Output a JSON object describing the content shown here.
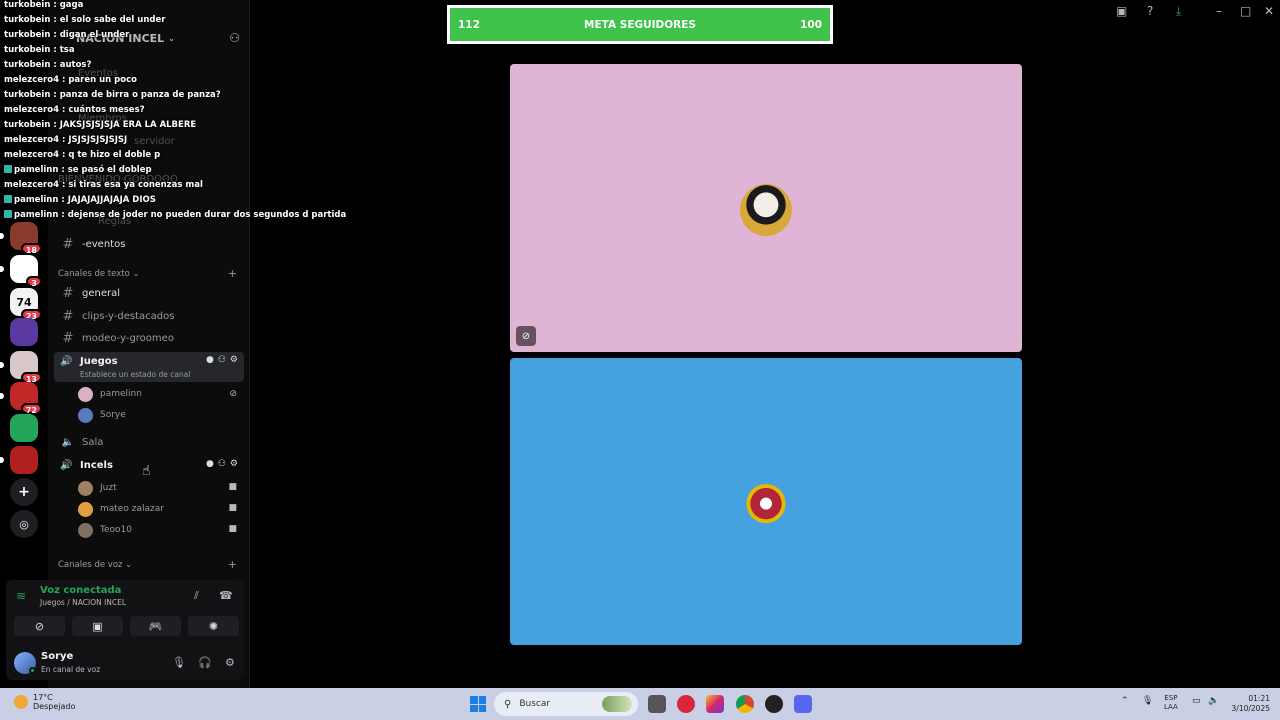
{
  "goal_bar": {
    "left_value": "112",
    "title": "META SEGUIDORES",
    "right_value": "100"
  },
  "server": {
    "name": "NACION INCEL",
    "faded_items": [
      "Eventos",
      "Miembros",
      "servidor",
      "BIENVENIDO GORDOOO",
      "Reglas"
    ],
    "rail": [
      {
        "label": "",
        "badge": "18",
        "color": "#8a3b2c"
      },
      {
        "label": "",
        "badge": "3",
        "color": "#ffffff"
      },
      {
        "label": "74",
        "badge": "23",
        "color": "#f2f2f2"
      },
      {
        "label": "",
        "badge": "",
        "color": "#5a3aa0"
      },
      {
        "label": "",
        "badge": "13",
        "color": "#d8c8c8"
      },
      {
        "label": "",
        "badge": "72",
        "color": "#c02828"
      },
      {
        "label": "",
        "badge": "",
        "color": "#23a55a"
      },
      {
        "label": "",
        "badge": "",
        "color": "#b02020"
      }
    ]
  },
  "channels": {
    "events_channel": "-eventos",
    "text_category": "Canales de texto",
    "text_channels": [
      "general",
      "clips-y-destacados",
      "modeo-y-groomeo"
    ],
    "voice_category": "Canales de voz",
    "voice_juegos": {
      "name": "Juegos",
      "status": "Establece un estado de canal",
      "members": [
        "pamelinn",
        "Sorye"
      ]
    },
    "voice_sala": "Sala",
    "voice_incels": {
      "name": "Incels",
      "members": [
        "Juzt",
        "mateo zalazar",
        "Teoo10"
      ]
    }
  },
  "voice_panel": {
    "status": "Voz conectada",
    "location": "Juegos / NACION INCEL"
  },
  "user": {
    "name": "Sorye",
    "status": "En canal de voz"
  },
  "chat": [
    {
      "user": "turkobein",
      "text": "gaga",
      "color": "#ffffff"
    },
    {
      "user": "turkobein",
      "text": "el solo sabe del under",
      "color": "#ffffff"
    },
    {
      "user": "turkobein",
      "text": "digan el under",
      "color": "#ffffff"
    },
    {
      "user": "turkobein",
      "text": "tsa",
      "color": "#ffffff"
    },
    {
      "user": "turkobein",
      "text": "autos?",
      "color": "#ffffff"
    },
    {
      "user": "melezcero4",
      "text": "paren un poco",
      "color": "#ffffff"
    },
    {
      "user": "turkobein",
      "text": "panza de birra o panza de panza?",
      "color": "#ffffff"
    },
    {
      "user": "melezcero4",
      "text": "cuántos meses?",
      "color": "#ffffff"
    },
    {
      "user": "turkobein",
      "text": "JAKSJSJSJSJA ERA LA ALBERE",
      "color": "#ffffff"
    },
    {
      "user": "melezcero4",
      "text": "JSJSJSJSJSJSJ",
      "color": "#ffffff"
    },
    {
      "user": "melezcero4",
      "text": "q te hizo el doble p",
      "color": "#ffffff"
    },
    {
      "user": "pamelinn",
      "text": "se pasó el doblep",
      "color": "#ffffff"
    },
    {
      "user": "melezcero4",
      "text": "si tiras esa ya conenzas mal",
      "color": "#ffffff"
    },
    {
      "user": "pamelinn",
      "text": "JAJAJAJJAJAJA DIOS",
      "color": "#ffffff"
    },
    {
      "user": "pamelinn",
      "text": "dejense de joder no pueden durar dos segundos d partida",
      "color": "#ffffff"
    }
  ],
  "taskbar": {
    "weather_temp": "17°C",
    "weather_desc": "Despejado",
    "search_placeholder": "Buscar",
    "lang_top": "ESP",
    "lang_bottom": "LAA",
    "time": "01:21",
    "date": "3/10/2025"
  },
  "colors": {
    "tile_top": "#e0b4d4",
    "tile_bottom": "#45a1e0",
    "goal_green": "#3ec24a",
    "voice_green": "#23a55a"
  }
}
